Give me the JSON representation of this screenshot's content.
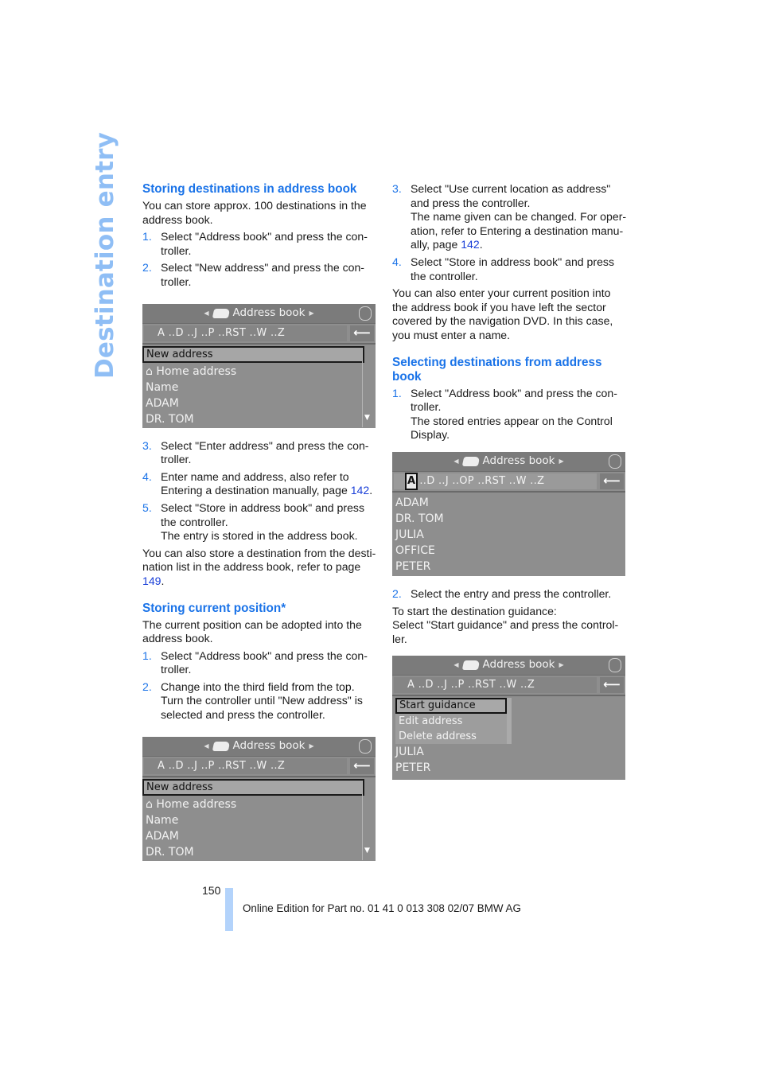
{
  "side_title": "Destination entry",
  "left": {
    "section1": {
      "heading": "Storing destinations in address book",
      "intro": "You can store approx. 100 destinations in the address book.",
      "steps_a": [
        {
          "num": "1.",
          "text": "Select \"Address book\" and press the con-troller."
        },
        {
          "num": "2.",
          "text": "Select \"New address\" and press the con-troller."
        }
      ],
      "screen": {
        "title": "Address book",
        "alpha": "A ..D ..J ..P ..RST ..W ..Z",
        "back_icon": "⟵",
        "items": [
          "New address",
          "⌂ Home address",
          "Name",
          "ADAM",
          "DR. TOM"
        ],
        "selected_index": 0
      },
      "steps_b": [
        {
          "num": "3.",
          "text": "Select \"Enter address\" and press the con-troller."
        },
        {
          "num": "4.",
          "text": "Enter name and address, also refer to Entering a destination manually, page ",
          "link": "142",
          "after": "."
        },
        {
          "num": "5.",
          "text": "Select \"Store in address book\" and press the controller.",
          "sub": "The entry is stored in the address book."
        }
      ],
      "outro": "You can also store a destination from the desti-nation list in the address book, refer to page ",
      "outro_link": "149",
      "outro_after": "."
    },
    "section2": {
      "heading": "Storing current position*",
      "intro": "The current position can be adopted into the address book.",
      "steps": [
        {
          "num": "1.",
          "text": "Select \"Address book\" and press the con-troller."
        },
        {
          "num": "2.",
          "text": "Change into the third field from the top. Turn the controller until \"New address\" is selected and press the controller."
        }
      ],
      "screen": {
        "title": "Address book",
        "alpha": "A ..D ..J ..P ..RST ..W ..Z",
        "back_icon": "⟵",
        "items": [
          "New address",
          "⌂ Home address",
          "Name",
          "ADAM",
          "DR. TOM"
        ],
        "selected_index": 0
      }
    }
  },
  "right": {
    "steps": [
      {
        "num": "3.",
        "text": "Select \"Use current location as address\" and press the controller.",
        "sub": "The name given can be changed. For oper-ation, refer to Entering a destination manu-ally, page ",
        "link": "142",
        "after": "."
      },
      {
        "num": "4.",
        "text": "Select \"Store in address book\" and press the controller."
      }
    ],
    "note": "You can also enter your current position into the address book if you have left the sector covered by the navigation DVD. In this case, you must enter a name.",
    "section3": {
      "heading": "Selecting destinations from address book",
      "steps_a": [
        {
          "num": "1.",
          "text": "Select \"Address book\" and press the con-troller.",
          "sub": "The stored entries appear on the Control Display."
        }
      ],
      "screen_a": {
        "title": "Address book",
        "alpha_cursor": "A",
        "alpha": "..D ..J ..OP ..RST ..W ..Z",
        "back_icon": "⟵",
        "items": [
          "ADAM",
          "DR. TOM",
          "JULIA",
          "OFFICE",
          "PETER"
        ]
      },
      "steps_b": [
        {
          "num": "2.",
          "text": "Select the entry and press the controller."
        }
      ],
      "guidance_intro": "To start the destination guidance:",
      "guidance_text": "Select \"Start guidance\" and press the control-ler.",
      "screen_b": {
        "title": "Address book",
        "alpha": "A ..D ..J ..P ..RST ..W ..Z",
        "back_icon": "⟵",
        "popup_items": [
          "Start guidance",
          "Edit address",
          "Delete address"
        ],
        "popup_selected_index": 0,
        "items": [
          "JULIA",
          "PETER"
        ]
      }
    }
  },
  "footer": {
    "page_number": "150",
    "edition": "Online Edition for Part no. 01 41 0 013 308 02/07 BMW AG",
    "accent_color": "#b3d3fb"
  }
}
